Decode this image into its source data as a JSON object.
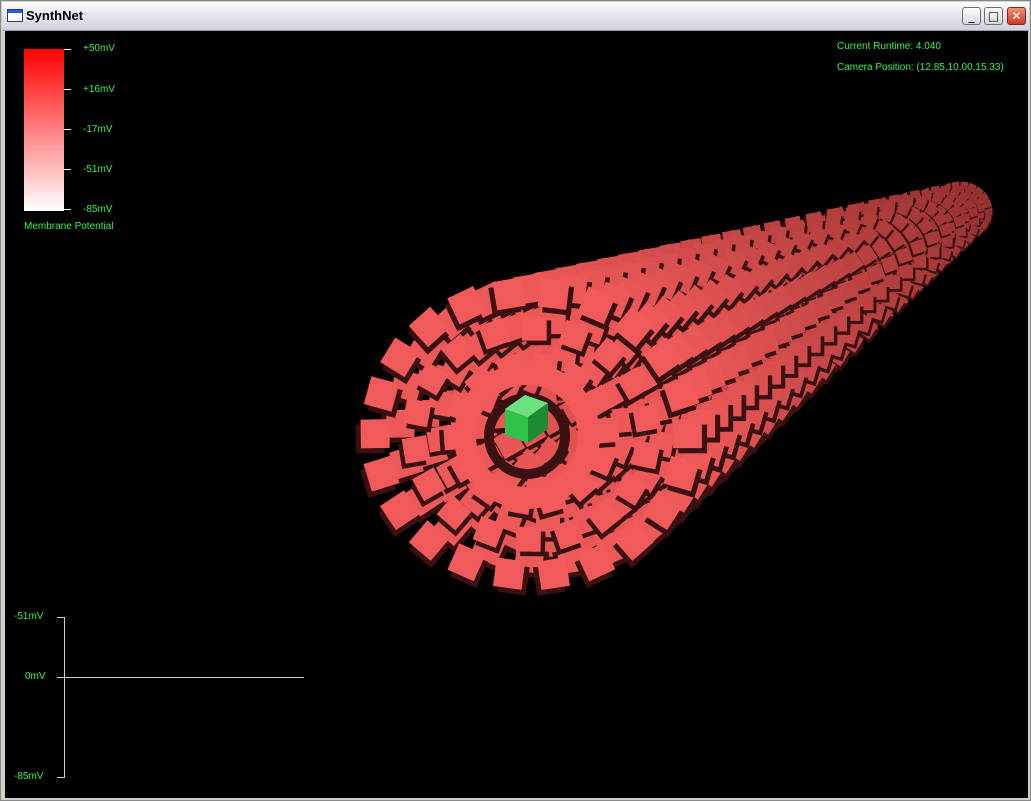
{
  "window": {
    "title": "SynthNet"
  },
  "hud": {
    "runtime": "Current Runtime: 4.040",
    "camera": "Camera Position: (12.85,10.00,15.33)"
  },
  "scale": {
    "labels": [
      "+50mV",
      "+16mV",
      "-17mV",
      "-51mV",
      "-85mV"
    ],
    "caption": "Membrane Potential",
    "top_color": "#ff0000",
    "bottom_color": "#ffffff"
  },
  "graph": {
    "labels": [
      "-51mV",
      "0mV",
      "-85mV"
    ]
  },
  "scene": {
    "neuron_color": "#f25a5a",
    "neuron_shadow": "#3a1010",
    "stimulus_color": "#2fc24a"
  }
}
